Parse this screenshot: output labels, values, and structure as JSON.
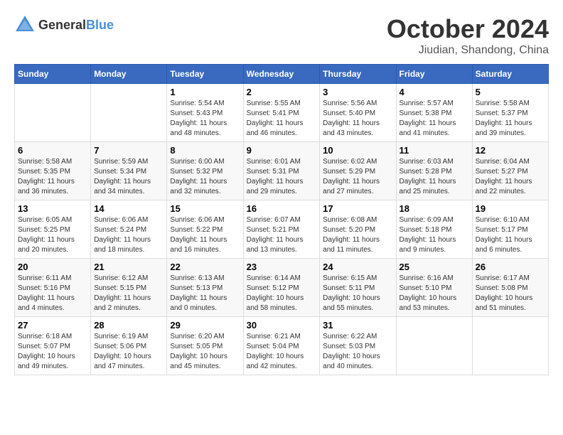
{
  "header": {
    "logo_general": "General",
    "logo_blue": "Blue",
    "title": "October 2024",
    "subtitle": "Jiudian, Shandong, China"
  },
  "columns": [
    "Sunday",
    "Monday",
    "Tuesday",
    "Wednesday",
    "Thursday",
    "Friday",
    "Saturday"
  ],
  "weeks": [
    [
      {
        "day": "",
        "info": ""
      },
      {
        "day": "",
        "info": ""
      },
      {
        "day": "1",
        "info": "Sunrise: 5:54 AM\nSunset: 5:43 PM\nDaylight: 11 hours and 48 minutes."
      },
      {
        "day": "2",
        "info": "Sunrise: 5:55 AM\nSunset: 5:41 PM\nDaylight: 11 hours and 46 minutes."
      },
      {
        "day": "3",
        "info": "Sunrise: 5:56 AM\nSunset: 5:40 PM\nDaylight: 11 hours and 43 minutes."
      },
      {
        "day": "4",
        "info": "Sunrise: 5:57 AM\nSunset: 5:38 PM\nDaylight: 11 hours and 41 minutes."
      },
      {
        "day": "5",
        "info": "Sunrise: 5:58 AM\nSunset: 5:37 PM\nDaylight: 11 hours and 39 minutes."
      }
    ],
    [
      {
        "day": "6",
        "info": "Sunrise: 5:58 AM\nSunset: 5:35 PM\nDaylight: 11 hours and 36 minutes."
      },
      {
        "day": "7",
        "info": "Sunrise: 5:59 AM\nSunset: 5:34 PM\nDaylight: 11 hours and 34 minutes."
      },
      {
        "day": "8",
        "info": "Sunrise: 6:00 AM\nSunset: 5:32 PM\nDaylight: 11 hours and 32 minutes."
      },
      {
        "day": "9",
        "info": "Sunrise: 6:01 AM\nSunset: 5:31 PM\nDaylight: 11 hours and 29 minutes."
      },
      {
        "day": "10",
        "info": "Sunrise: 6:02 AM\nSunset: 5:29 PM\nDaylight: 11 hours and 27 minutes."
      },
      {
        "day": "11",
        "info": "Sunrise: 6:03 AM\nSunset: 5:28 PM\nDaylight: 11 hours and 25 minutes."
      },
      {
        "day": "12",
        "info": "Sunrise: 6:04 AM\nSunset: 5:27 PM\nDaylight: 11 hours and 22 minutes."
      }
    ],
    [
      {
        "day": "13",
        "info": "Sunrise: 6:05 AM\nSunset: 5:25 PM\nDaylight: 11 hours and 20 minutes."
      },
      {
        "day": "14",
        "info": "Sunrise: 6:06 AM\nSunset: 5:24 PM\nDaylight: 11 hours and 18 minutes."
      },
      {
        "day": "15",
        "info": "Sunrise: 6:06 AM\nSunset: 5:22 PM\nDaylight: 11 hours and 16 minutes."
      },
      {
        "day": "16",
        "info": "Sunrise: 6:07 AM\nSunset: 5:21 PM\nDaylight: 11 hours and 13 minutes."
      },
      {
        "day": "17",
        "info": "Sunrise: 6:08 AM\nSunset: 5:20 PM\nDaylight: 11 hours and 11 minutes."
      },
      {
        "day": "18",
        "info": "Sunrise: 6:09 AM\nSunset: 5:18 PM\nDaylight: 11 hours and 9 minutes."
      },
      {
        "day": "19",
        "info": "Sunrise: 6:10 AM\nSunset: 5:17 PM\nDaylight: 11 hours and 6 minutes."
      }
    ],
    [
      {
        "day": "20",
        "info": "Sunrise: 6:11 AM\nSunset: 5:16 PM\nDaylight: 11 hours and 4 minutes."
      },
      {
        "day": "21",
        "info": "Sunrise: 6:12 AM\nSunset: 5:15 PM\nDaylight: 11 hours and 2 minutes."
      },
      {
        "day": "22",
        "info": "Sunrise: 6:13 AM\nSunset: 5:13 PM\nDaylight: 11 hours and 0 minutes."
      },
      {
        "day": "23",
        "info": "Sunrise: 6:14 AM\nSunset: 5:12 PM\nDaylight: 10 hours and 58 minutes."
      },
      {
        "day": "24",
        "info": "Sunrise: 6:15 AM\nSunset: 5:11 PM\nDaylight: 10 hours and 55 minutes."
      },
      {
        "day": "25",
        "info": "Sunrise: 6:16 AM\nSunset: 5:10 PM\nDaylight: 10 hours and 53 minutes."
      },
      {
        "day": "26",
        "info": "Sunrise: 6:17 AM\nSunset: 5:08 PM\nDaylight: 10 hours and 51 minutes."
      }
    ],
    [
      {
        "day": "27",
        "info": "Sunrise: 6:18 AM\nSunset: 5:07 PM\nDaylight: 10 hours and 49 minutes."
      },
      {
        "day": "28",
        "info": "Sunrise: 6:19 AM\nSunset: 5:06 PM\nDaylight: 10 hours and 47 minutes."
      },
      {
        "day": "29",
        "info": "Sunrise: 6:20 AM\nSunset: 5:05 PM\nDaylight: 10 hours and 45 minutes."
      },
      {
        "day": "30",
        "info": "Sunrise: 6:21 AM\nSunset: 5:04 PM\nDaylight: 10 hours and 42 minutes."
      },
      {
        "day": "31",
        "info": "Sunrise: 6:22 AM\nSunset: 5:03 PM\nDaylight: 10 hours and 40 minutes."
      },
      {
        "day": "",
        "info": ""
      },
      {
        "day": "",
        "info": ""
      }
    ]
  ]
}
